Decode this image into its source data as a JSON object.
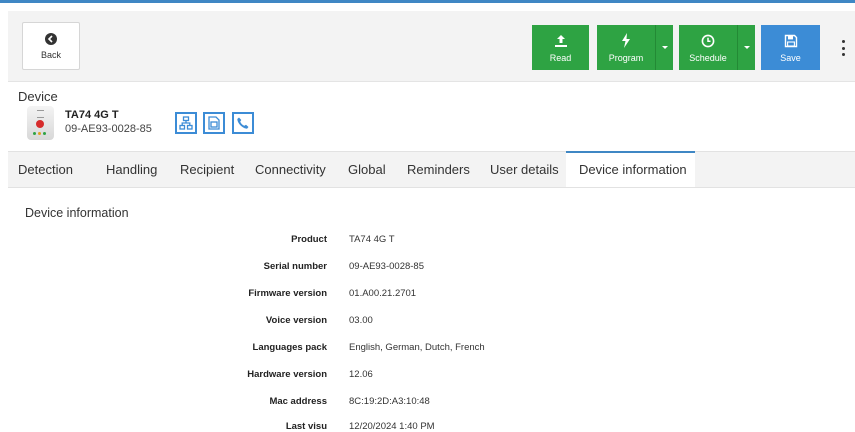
{
  "toolbar": {
    "back_label": "Back",
    "read_label": "Read",
    "program_label": "Program",
    "schedule_label": "Schedule",
    "save_label": "Save"
  },
  "device": {
    "section_label": "Device",
    "name": "TA74 4G T",
    "serial": "09-AE93-0028-85",
    "icons": [
      "network-icon",
      "sim-card-icon",
      "phone-icon"
    ]
  },
  "tabs": [
    {
      "label": "Detection"
    },
    {
      "label": "Handling"
    },
    {
      "label": "Recipient"
    },
    {
      "label": "Connectivity"
    },
    {
      "label": "Global"
    },
    {
      "label": "Reminders"
    },
    {
      "label": "User details"
    },
    {
      "label": "Device information",
      "active": true
    }
  ],
  "info": {
    "title": "Device information",
    "rows": [
      {
        "label": "Product",
        "value": "TA74 4G T"
      },
      {
        "label": "Serial number",
        "value": "09-AE93-0028-85"
      },
      {
        "label": "Firmware version",
        "value": "01.A00.21.2701"
      },
      {
        "label": "Voice version",
        "value": "03.00"
      },
      {
        "label": "Languages pack",
        "value": "English, German, Dutch, French"
      },
      {
        "label": "Hardware version",
        "value": "12.06"
      },
      {
        "label": "Mac address",
        "value": "8C:19:2D:A3:10:48"
      },
      {
        "label": "Last visu",
        "value": "12/20/2024 1:40 PM"
      }
    ]
  },
  "colors": {
    "accent": "#3f87c4",
    "green_button": "#2ea343",
    "blue_button": "#3c8cd6"
  }
}
